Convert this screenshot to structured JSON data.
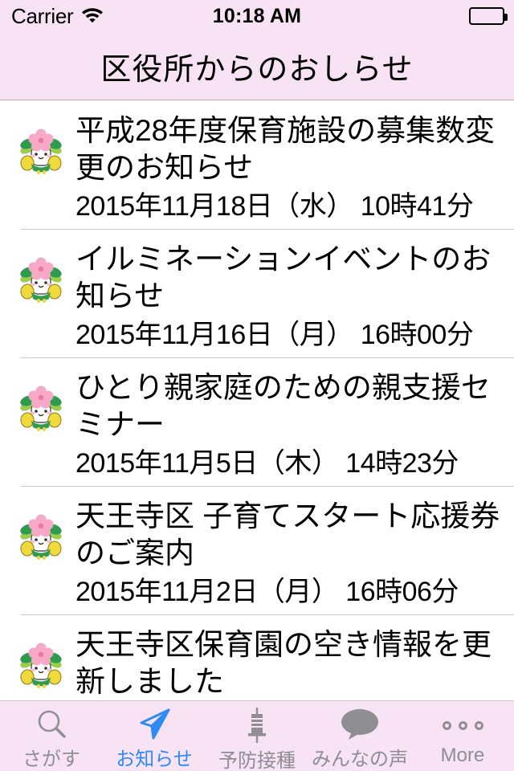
{
  "status_bar": {
    "carrier": "Carrier",
    "wifi_icon": "wifi-icon",
    "time": "10:18 AM",
    "battery_icon": "battery-full-icon"
  },
  "nav_bar": {
    "title": "区役所からのおしらせ"
  },
  "colors": {
    "bar_background": "#F8E3F4",
    "active_tint": "#2f8bf5",
    "inactive_tint": "#8e8e93",
    "text": "#000000",
    "separator": "#c8c7cc"
  },
  "list": {
    "items": [
      {
        "icon": "mascot-icon",
        "title": "平成28年度保育施設の募集数変更のお知らせ",
        "date": "2015年11月18日（水） 10時41分"
      },
      {
        "icon": "mascot-icon",
        "title": "イルミネーションイベントのお知らせ",
        "date": "2015年11月16日（月） 16時00分"
      },
      {
        "icon": "mascot-icon",
        "title": "ひとり親家庭のための親支援セミナー",
        "date": "2015年11月5日（木） 14時23分"
      },
      {
        "icon": "mascot-icon",
        "title": "天王寺区 子育てスタート応援券のご案内",
        "date": "2015年11月2日（月） 16時06分"
      },
      {
        "icon": "mascot-icon",
        "title": "天王寺区保育園の空き情報を更新しました",
        "date": ""
      }
    ]
  },
  "tab_bar": {
    "tabs": [
      {
        "icon": "search-icon",
        "label": "さがす",
        "active": false
      },
      {
        "icon": "paper-plane-icon",
        "label": "お知らせ",
        "active": true
      },
      {
        "icon": "syringe-icon",
        "label": "予防接種",
        "active": false
      },
      {
        "icon": "speech-bubble-icon",
        "label": "みんなの声",
        "active": false
      },
      {
        "icon": "ellipsis-icon",
        "label": "More",
        "active": false
      }
    ]
  }
}
